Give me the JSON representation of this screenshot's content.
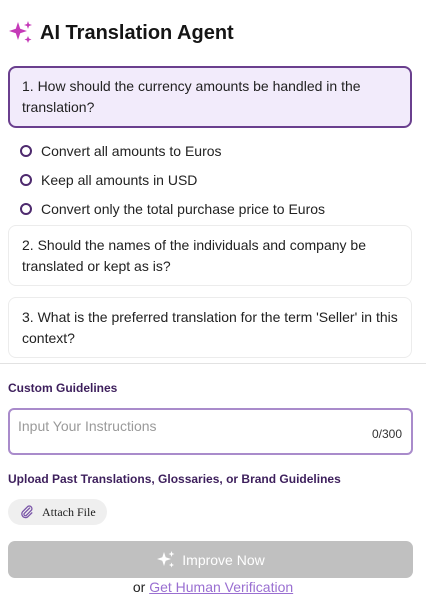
{
  "header": {
    "title": "AI Translation Agent",
    "icon": "sparkle-icon",
    "accent": "#c53ab8"
  },
  "questions": [
    {
      "text": "1. How should the currency amounts be handled in the translation?",
      "active": true
    },
    {
      "text": "2. Should the names of the individuals and company be translated or kept as is?",
      "active": false
    },
    {
      "text": "3. What is the preferred translation for the term 'Seller' in this context?",
      "active": false
    }
  ],
  "options": [
    {
      "label": "Convert all amounts to Euros"
    },
    {
      "label": "Keep all amounts in USD"
    },
    {
      "label": "Convert only the total purchase price to Euros"
    }
  ],
  "guidelines": {
    "label": "Custom Guidelines",
    "placeholder": "Input Your Instructions",
    "counter": "0/300"
  },
  "upload": {
    "label": "Upload Past Translations, Glossaries, or Brand Guidelines",
    "attach_label": "Attach File",
    "icon": "paperclip-icon"
  },
  "actions": {
    "improve_label": "Improve Now",
    "improve_icon": "sparkle-icon",
    "or_text": "or",
    "human_link": "Get Human Verification"
  },
  "colors": {
    "active_border": "#6a3f8e",
    "active_bg": "#f2ebfb",
    "label_color": "#3d1f5c",
    "link_color": "#9a6fd1",
    "button_disabled": "#c0c0c0"
  }
}
